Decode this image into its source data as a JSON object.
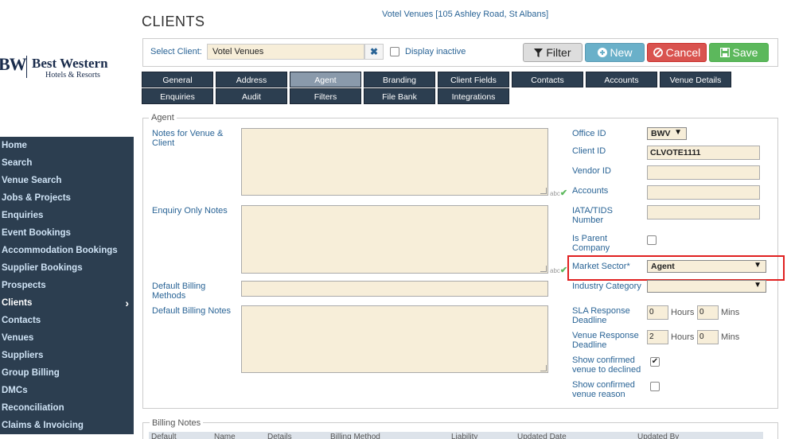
{
  "page": {
    "title": "CLIENTS",
    "venue_header": "Votel Venues [105 Ashley Road, St Albans]"
  },
  "logo": {
    "mark": "BW",
    "name": "Best Western",
    "sub": "Hotels & Resorts"
  },
  "nav": {
    "items": [
      "Home",
      "Search",
      "Venue Search",
      "Jobs & Projects",
      "Enquiries",
      "Event Bookings",
      "Accommodation Bookings",
      "Supplier Bookings",
      "Prospects",
      "Clients",
      "Contacts",
      "Venues",
      "Suppliers",
      "Group Billing",
      "DMCs",
      "Reconciliation",
      "Claims & Invoicing"
    ],
    "active": "Clients",
    "chevron": "›"
  },
  "toolbar": {
    "select_client_label": "Select Client:",
    "client_value": "Votel Venues",
    "clear": "✖",
    "display_inactive": "Display inactive",
    "filter": "Filter",
    "new": "New",
    "cancel": "Cancel",
    "save": "Save"
  },
  "tabs": {
    "row1": [
      "General",
      "Address",
      "Agent",
      "Branding",
      "Client Fields",
      "Contacts",
      "Accounts",
      "Venue Details"
    ],
    "row2": [
      "Enquiries",
      "Audit",
      "Filters",
      "File Bank",
      "Integrations"
    ],
    "active": "Agent"
  },
  "agent": {
    "legend": "Agent",
    "notes_venue_client_label": "Notes for Venue & Client",
    "enquiry_only_notes_label": "Enquiry Only Notes",
    "default_billing_methods_label": "Default Billing Methods",
    "default_billing_notes_label": "Default Billing Notes",
    "spell_abc": "abc",
    "spell_tick": "✔",
    "office_id_label": "Office ID",
    "office_id_value": "BWV",
    "client_id_label": "Client ID",
    "client_id_value": "CLVOTE1111",
    "vendor_id_label": "Vendor ID",
    "vendor_id_value": "",
    "accounts_label": "Accounts",
    "accounts_value": "",
    "iata_label": "IATA/TIDS Number",
    "iata_value": "",
    "is_parent_label": "Is Parent Company",
    "market_sector_label": "Market Sector*",
    "market_sector_value": "Agent",
    "industry_category_label": "Industry Category",
    "industry_category_value": "",
    "sla_label": "SLA Response Deadline",
    "sla_hours": "0",
    "sla_mins": "0",
    "venue_response_label": "Venue Response Deadline",
    "venue_hours": "2",
    "venue_mins": "0",
    "hours_unit": "Hours",
    "mins_unit": "Mins",
    "show_confirmed_declined_label": "Show confirmed venue to declined",
    "show_confirmed_reason_label": "Show confirmed venue reason",
    "dropdown_arrow": "▼",
    "check_mark": "✔"
  },
  "billing": {
    "legend": "Billing Notes",
    "columns": [
      "Default",
      "Name",
      "Details",
      "Billing Method",
      "Liability",
      "Updated Date",
      "Updated By"
    ]
  },
  "colors": {
    "nav_bg": "#2c3e50",
    "input_bg": "#f7eed9",
    "highlight": "#e02020"
  }
}
